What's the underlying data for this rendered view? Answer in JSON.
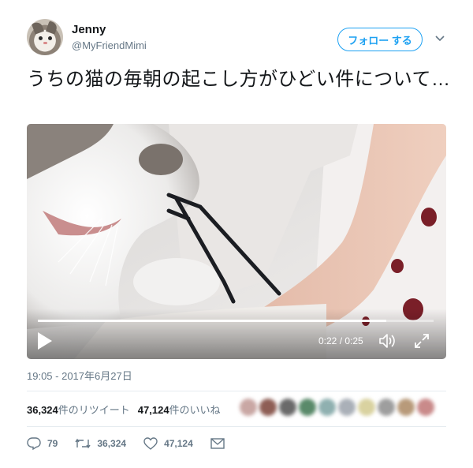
{
  "user": {
    "display_name": "Jenny",
    "handle": "@MyFriendMimi",
    "avatar_icon": "cat-avatar"
  },
  "follow_button": {
    "label": "フォロー する"
  },
  "caret_icon": "chevron-down-icon",
  "tweet": {
    "text": "うちの猫の毎朝の起こし方がひどい件について…"
  },
  "video": {
    "time_display": "0:22 / 0:25",
    "progress": 0.88,
    "play_icon": "play-icon",
    "volume_icon": "volume-icon",
    "fullscreen_icon": "fullscreen-icon"
  },
  "timestamp": "19:05 - 2017年6月27日",
  "stats": {
    "retweets_count": "36,324",
    "retweets_label": "件のリツイート",
    "likes_count": "47,124",
    "likes_label": "件のいいね",
    "likers_colors": [
      "#c9a7a4",
      "#8e5e55",
      "#6a6a6a",
      "#5a8a6a",
      "#8fb0b0",
      "#aab0b8",
      "#d9d2a0",
      "#9e9e9e",
      "#b89a7a",
      "#c98a8a"
    ]
  },
  "actions": {
    "reply_count": "79",
    "retweet_count": "36,324",
    "like_count": "47,124",
    "reply_icon": "reply-icon",
    "retweet_icon": "retweet-icon",
    "like_icon": "heart-icon",
    "dm_icon": "envelope-icon"
  }
}
